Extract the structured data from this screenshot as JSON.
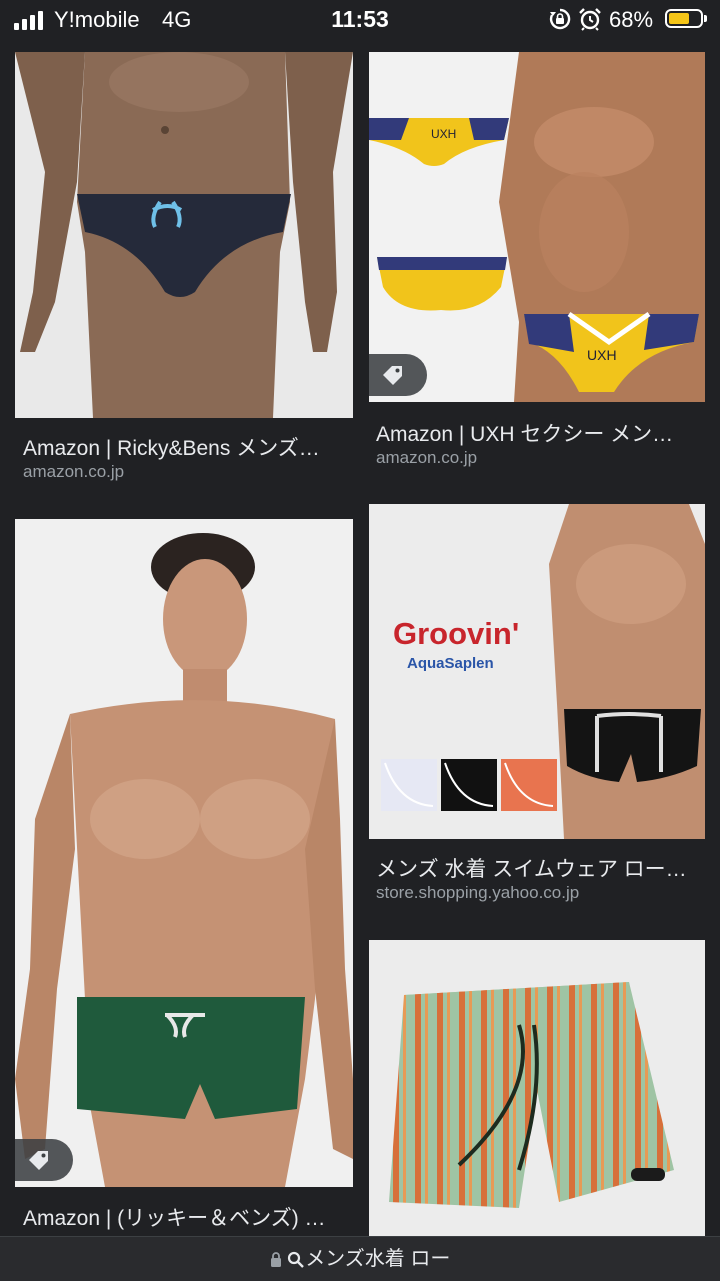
{
  "status_bar": {
    "carrier": "Y!mobile",
    "network": "4G",
    "time": "11:53",
    "battery_percent": "68%",
    "battery_level": 0.68,
    "icons": [
      "signal-icon",
      "rotation-lock-icon",
      "alarm-icon",
      "battery-icon"
    ]
  },
  "results": [
    {
      "title": "Amazon | Ricky&Bens メンズ…",
      "source": "amazon.co.jp",
      "has_product_badge": false
    },
    {
      "title": "Amazon | UXH セクシー メン…",
      "source": "amazon.co.jp",
      "has_product_badge": true,
      "brand_text": "UXH"
    },
    {
      "title": "Amazon | (リッキー＆ベンズ) …",
      "source": "",
      "has_product_badge": true
    },
    {
      "title": "メンズ 水着 スイムウェア ロー…",
      "source": "store.shopping.yahoo.co.jp",
      "has_product_badge": false,
      "logo_text": "Groovin'",
      "logo_subtext": "AquaSaplen"
    },
    {
      "title": "",
      "source": "",
      "has_product_badge": false
    }
  ],
  "url_bar": {
    "text": "メンズ水着 ロー",
    "icons": [
      "lock-icon",
      "search-icon"
    ]
  },
  "colors": {
    "background": "#202124",
    "title_text": "#e8eaed",
    "source_text": "#9aa0a6",
    "battery_fill": "#f5c518"
  }
}
